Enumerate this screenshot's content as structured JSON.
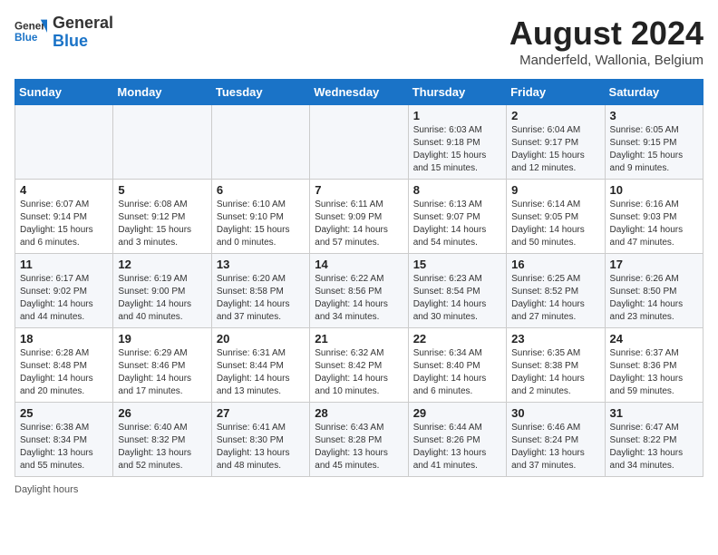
{
  "header": {
    "logo_general": "General",
    "logo_blue": "Blue",
    "title": "August 2024",
    "location": "Manderfeld, Wallonia, Belgium"
  },
  "days_of_week": [
    "Sunday",
    "Monday",
    "Tuesday",
    "Wednesday",
    "Thursday",
    "Friday",
    "Saturday"
  ],
  "weeks": [
    [
      {
        "day": "",
        "info": ""
      },
      {
        "day": "",
        "info": ""
      },
      {
        "day": "",
        "info": ""
      },
      {
        "day": "",
        "info": ""
      },
      {
        "day": "1",
        "info": "Sunrise: 6:03 AM\nSunset: 9:18 PM\nDaylight: 15 hours\nand 15 minutes."
      },
      {
        "day": "2",
        "info": "Sunrise: 6:04 AM\nSunset: 9:17 PM\nDaylight: 15 hours\nand 12 minutes."
      },
      {
        "day": "3",
        "info": "Sunrise: 6:05 AM\nSunset: 9:15 PM\nDaylight: 15 hours\nand 9 minutes."
      }
    ],
    [
      {
        "day": "4",
        "info": "Sunrise: 6:07 AM\nSunset: 9:14 PM\nDaylight: 15 hours\nand 6 minutes."
      },
      {
        "day": "5",
        "info": "Sunrise: 6:08 AM\nSunset: 9:12 PM\nDaylight: 15 hours\nand 3 minutes."
      },
      {
        "day": "6",
        "info": "Sunrise: 6:10 AM\nSunset: 9:10 PM\nDaylight: 15 hours\nand 0 minutes."
      },
      {
        "day": "7",
        "info": "Sunrise: 6:11 AM\nSunset: 9:09 PM\nDaylight: 14 hours\nand 57 minutes."
      },
      {
        "day": "8",
        "info": "Sunrise: 6:13 AM\nSunset: 9:07 PM\nDaylight: 14 hours\nand 54 minutes."
      },
      {
        "day": "9",
        "info": "Sunrise: 6:14 AM\nSunset: 9:05 PM\nDaylight: 14 hours\nand 50 minutes."
      },
      {
        "day": "10",
        "info": "Sunrise: 6:16 AM\nSunset: 9:03 PM\nDaylight: 14 hours\nand 47 minutes."
      }
    ],
    [
      {
        "day": "11",
        "info": "Sunrise: 6:17 AM\nSunset: 9:02 PM\nDaylight: 14 hours\nand 44 minutes."
      },
      {
        "day": "12",
        "info": "Sunrise: 6:19 AM\nSunset: 9:00 PM\nDaylight: 14 hours\nand 40 minutes."
      },
      {
        "day": "13",
        "info": "Sunrise: 6:20 AM\nSunset: 8:58 PM\nDaylight: 14 hours\nand 37 minutes."
      },
      {
        "day": "14",
        "info": "Sunrise: 6:22 AM\nSunset: 8:56 PM\nDaylight: 14 hours\nand 34 minutes."
      },
      {
        "day": "15",
        "info": "Sunrise: 6:23 AM\nSunset: 8:54 PM\nDaylight: 14 hours\nand 30 minutes."
      },
      {
        "day": "16",
        "info": "Sunrise: 6:25 AM\nSunset: 8:52 PM\nDaylight: 14 hours\nand 27 minutes."
      },
      {
        "day": "17",
        "info": "Sunrise: 6:26 AM\nSunset: 8:50 PM\nDaylight: 14 hours\nand 23 minutes."
      }
    ],
    [
      {
        "day": "18",
        "info": "Sunrise: 6:28 AM\nSunset: 8:48 PM\nDaylight: 14 hours\nand 20 minutes."
      },
      {
        "day": "19",
        "info": "Sunrise: 6:29 AM\nSunset: 8:46 PM\nDaylight: 14 hours\nand 17 minutes."
      },
      {
        "day": "20",
        "info": "Sunrise: 6:31 AM\nSunset: 8:44 PM\nDaylight: 14 hours\nand 13 minutes."
      },
      {
        "day": "21",
        "info": "Sunrise: 6:32 AM\nSunset: 8:42 PM\nDaylight: 14 hours\nand 10 minutes."
      },
      {
        "day": "22",
        "info": "Sunrise: 6:34 AM\nSunset: 8:40 PM\nDaylight: 14 hours\nand 6 minutes."
      },
      {
        "day": "23",
        "info": "Sunrise: 6:35 AM\nSunset: 8:38 PM\nDaylight: 14 hours\nand 2 minutes."
      },
      {
        "day": "24",
        "info": "Sunrise: 6:37 AM\nSunset: 8:36 PM\nDaylight: 13 hours\nand 59 minutes."
      }
    ],
    [
      {
        "day": "25",
        "info": "Sunrise: 6:38 AM\nSunset: 8:34 PM\nDaylight: 13 hours\nand 55 minutes."
      },
      {
        "day": "26",
        "info": "Sunrise: 6:40 AM\nSunset: 8:32 PM\nDaylight: 13 hours\nand 52 minutes."
      },
      {
        "day": "27",
        "info": "Sunrise: 6:41 AM\nSunset: 8:30 PM\nDaylight: 13 hours\nand 48 minutes."
      },
      {
        "day": "28",
        "info": "Sunrise: 6:43 AM\nSunset: 8:28 PM\nDaylight: 13 hours\nand 45 minutes."
      },
      {
        "day": "29",
        "info": "Sunrise: 6:44 AM\nSunset: 8:26 PM\nDaylight: 13 hours\nand 41 minutes."
      },
      {
        "day": "30",
        "info": "Sunrise: 6:46 AM\nSunset: 8:24 PM\nDaylight: 13 hours\nand 37 minutes."
      },
      {
        "day": "31",
        "info": "Sunrise: 6:47 AM\nSunset: 8:22 PM\nDaylight: 13 hours\nand 34 minutes."
      }
    ]
  ],
  "footer": {
    "note": "Daylight hours"
  }
}
